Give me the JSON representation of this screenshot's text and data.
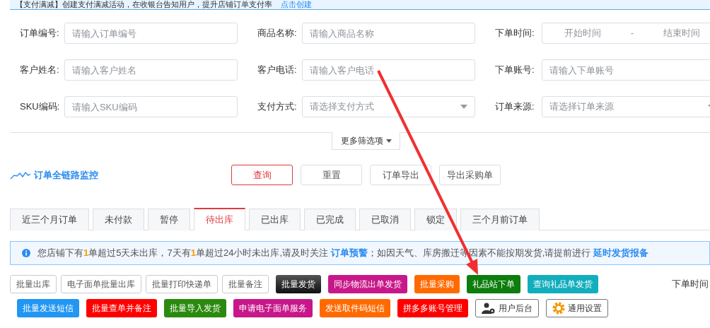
{
  "promo_banner": {
    "text": "【支付满减】创建支付满减活动，在收银台告知用户，提升店铺订单支付率",
    "link": "点击创建"
  },
  "filters": [
    {
      "label": "订单编号:",
      "kind": "text",
      "placeholder": "请输入订单编号"
    },
    {
      "label": "商品名称:",
      "kind": "text",
      "placeholder": "请输入商品名称"
    },
    {
      "label": "下单时间:",
      "kind": "daterange",
      "start_placeholder": "开始时间",
      "separator": "-",
      "end_placeholder": "结束时间"
    },
    {
      "label": "客户姓名:",
      "kind": "text",
      "placeholder": "请输入客户姓名"
    },
    {
      "label": "客户电话:",
      "kind": "text",
      "placeholder": "请输入客户电话"
    },
    {
      "label": "下单账号:",
      "kind": "text",
      "placeholder": "请输入下单账号"
    },
    {
      "label": "SKU编码:",
      "kind": "text",
      "placeholder": "请输入SKU编码"
    },
    {
      "label": "支付方式:",
      "kind": "select",
      "placeholder": "请选择支付方式"
    },
    {
      "label": "订单来源:",
      "kind": "select",
      "placeholder": "请选择订单来源"
    }
  ],
  "more_filters": {
    "label": "更多筛选项",
    "expanded": false
  },
  "monitor_link": "订单全链路监控",
  "actions": [
    {
      "label": "查询",
      "kind": "primary"
    },
    {
      "label": "重置",
      "kind": "plain"
    },
    {
      "label": "订单导出",
      "kind": "plain"
    },
    {
      "label": "导出采购单",
      "kind": "plain"
    }
  ],
  "tabs": [
    {
      "label": "近三个月订单",
      "selected": false
    },
    {
      "label": "未付款",
      "selected": false
    },
    {
      "label": "暂停",
      "selected": false
    },
    {
      "label": "待出库",
      "selected": true
    },
    {
      "label": "已出库",
      "selected": false
    },
    {
      "label": "已完成",
      "selected": false
    },
    {
      "label": "已取消",
      "selected": false
    },
    {
      "label": "锁定",
      "selected": false
    },
    {
      "label": "三个月前订单",
      "selected": false
    }
  ],
  "alert": [
    {
      "kind": "text",
      "text": "您店铺下有"
    },
    {
      "kind": "count",
      "text": "1"
    },
    {
      "kind": "text",
      "text": "单超过5天未出库，7天有"
    },
    {
      "kind": "count",
      "text": "1"
    },
    {
      "kind": "text",
      "text": "单超过24小时未出库,请及时关注 "
    },
    {
      "kind": "link",
      "text": "订单预警"
    },
    {
      "kind": "text",
      "text": "；如因天气、库房搬迁等因素不能按期发货,请提前进行 "
    },
    {
      "kind": "link",
      "text": "延时发货报备"
    }
  ],
  "batch_buttons": [
    [
      {
        "label": "批量出库",
        "kind": "plain"
      },
      {
        "label": "电子面单批量出库",
        "kind": "plain"
      },
      {
        "label": "批量打印快递单",
        "kind": "plain"
      },
      {
        "label": "批量备注",
        "kind": "plain"
      },
      {
        "label": "批量发货",
        "kind": "dark"
      },
      {
        "label": "同步物流出单发货",
        "kind": "filled",
        "color": "#c8178a"
      },
      {
        "label": "批量采购",
        "kind": "filled",
        "color": "#ff6a00"
      },
      {
        "label": "礼品站下单",
        "kind": "filled",
        "color": "#0d7d0d"
      },
      {
        "label": "查询礼品单发货",
        "kind": "filled",
        "color": "#12aebd"
      }
    ],
    [
      {
        "label": "批量发送短信",
        "kind": "filled",
        "color": "#2196f3"
      },
      {
        "label": "批量查单并备注",
        "kind": "filled",
        "color": "#ff0000"
      },
      {
        "label": "批量导入发货",
        "kind": "filled",
        "color": "#2a8a0e"
      },
      {
        "label": "申请电子面单服务",
        "kind": "filled",
        "color": "#c8178a"
      },
      {
        "label": "发送取件码短信",
        "kind": "filled",
        "color": "#ff6a00"
      },
      {
        "label": "拼多多账号管理",
        "kind": "filled",
        "color": "#ff0000"
      },
      {
        "label": "用户后台",
        "kind": "user"
      },
      {
        "label": "通用设置",
        "kind": "settings"
      }
    ]
  ],
  "sort_label": "下单时间"
}
